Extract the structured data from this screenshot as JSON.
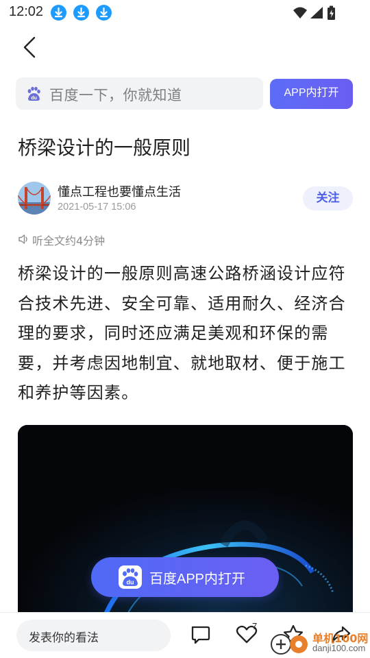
{
  "status_bar": {
    "time": "12:02",
    "notification_icons": [
      "download-icon",
      "download-icon",
      "download-icon"
    ],
    "system_icons": [
      "wifi-icon",
      "signal-icon",
      "battery-icon"
    ]
  },
  "header": {
    "back_icon": "back-arrow-icon",
    "search_placeholder": "百度一下，你就知道",
    "open_app_label": "APP内打开"
  },
  "article": {
    "title": "桥梁设计的一般原则",
    "author": {
      "name": "懂点工程也要懂点生活",
      "publish_time": "2021-05-17 15:06",
      "follow_label": "关注"
    },
    "listen_label": "听全文约4分钟",
    "body": "桥梁设计的一般原则高速公路桥涵设计应符合技术先进、安全可靠、适用耐久、经济合理的要求，同时还应满足美观和环保的需要，并考虑因地制宜、就地取材、便于施工和养护等因素。"
  },
  "floating_button": {
    "label": "百度APP内打开"
  },
  "bottom_bar": {
    "comment_placeholder": "发表你的看法",
    "like_count": "7",
    "icons": [
      "comment-icon",
      "like-icon",
      "collect-icon",
      "share-icon"
    ]
  },
  "watermark": {
    "line1": "单机100网",
    "line2": "danji100.com"
  },
  "colors": {
    "accent": "#5c6df6",
    "follow_text": "#4e5ee8",
    "follow_bg": "#eef0fb",
    "download_badge": "#1e9bff",
    "muted_text": "#9a9a9a"
  }
}
